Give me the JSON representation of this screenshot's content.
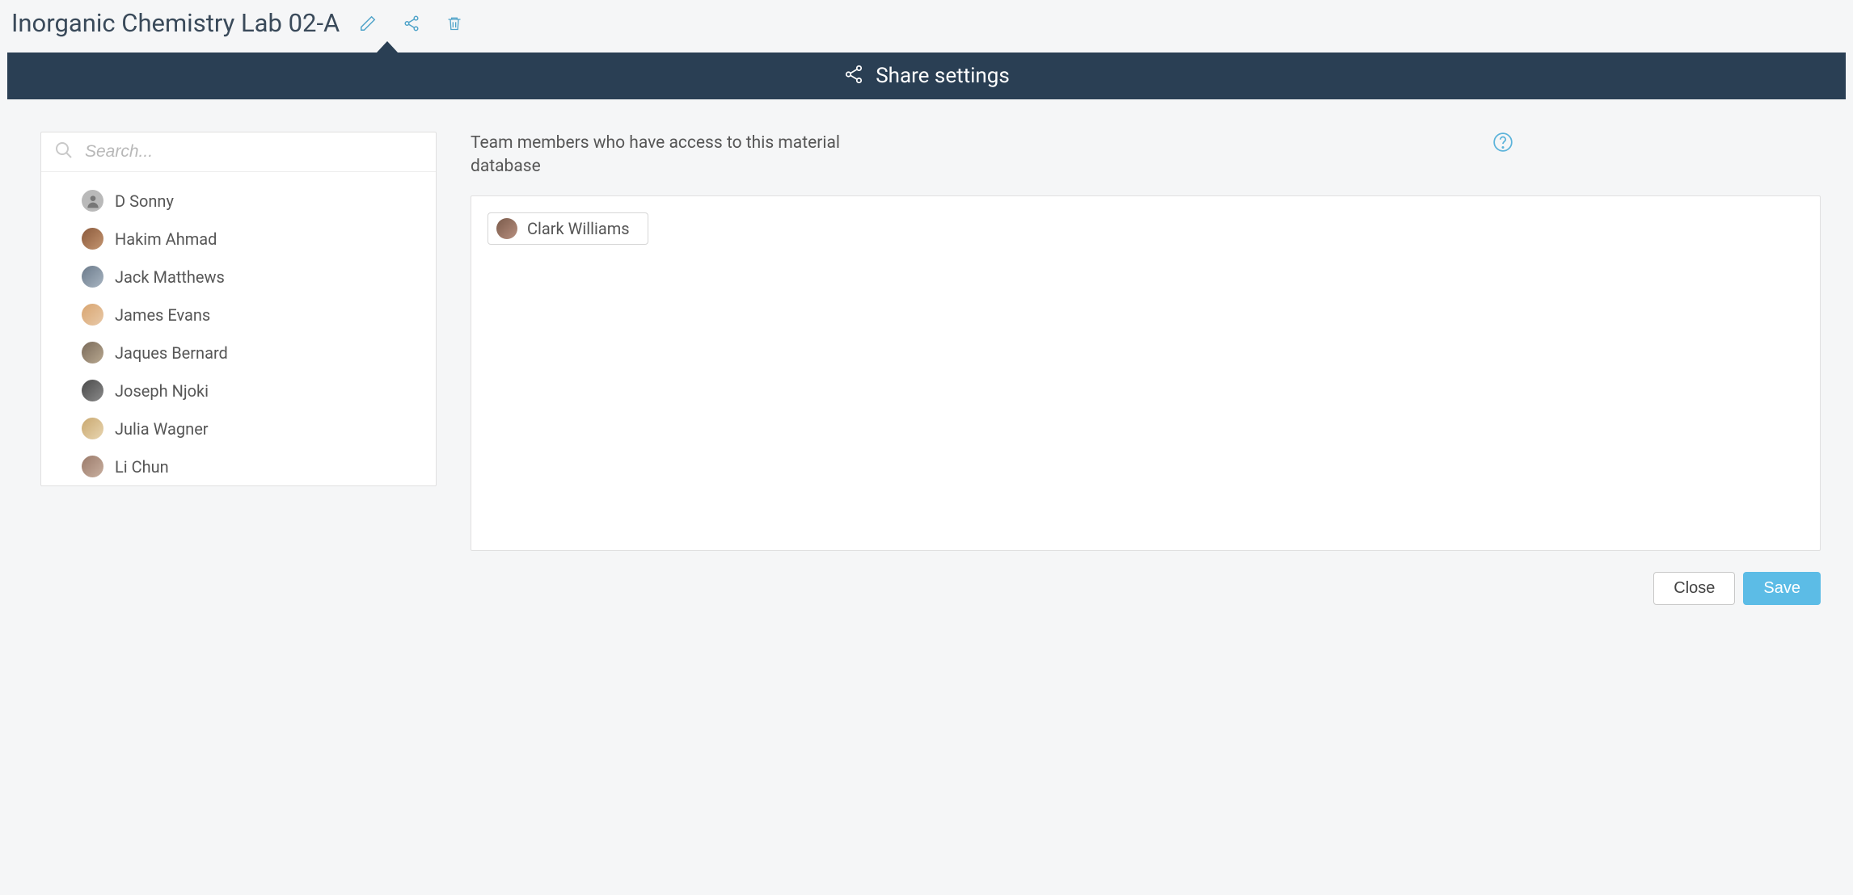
{
  "header": {
    "title": "Inorganic Chemistry Lab 02-A"
  },
  "panel": {
    "title": "Share settings"
  },
  "search": {
    "placeholder": "Search..."
  },
  "rightLabel": "Team members who have access to this material database",
  "members": [
    {
      "name": "D Sonny"
    },
    {
      "name": "Hakim Ahmad"
    },
    {
      "name": "Jack Matthews"
    },
    {
      "name": "James Evans"
    },
    {
      "name": "Jaques Bernard"
    },
    {
      "name": "Joseph Njoki"
    },
    {
      "name": "Julia Wagner"
    },
    {
      "name": "Li Chun"
    }
  ],
  "access": [
    {
      "name": "Clark Williams"
    }
  ],
  "buttons": {
    "close": "Close",
    "save": "Save"
  }
}
